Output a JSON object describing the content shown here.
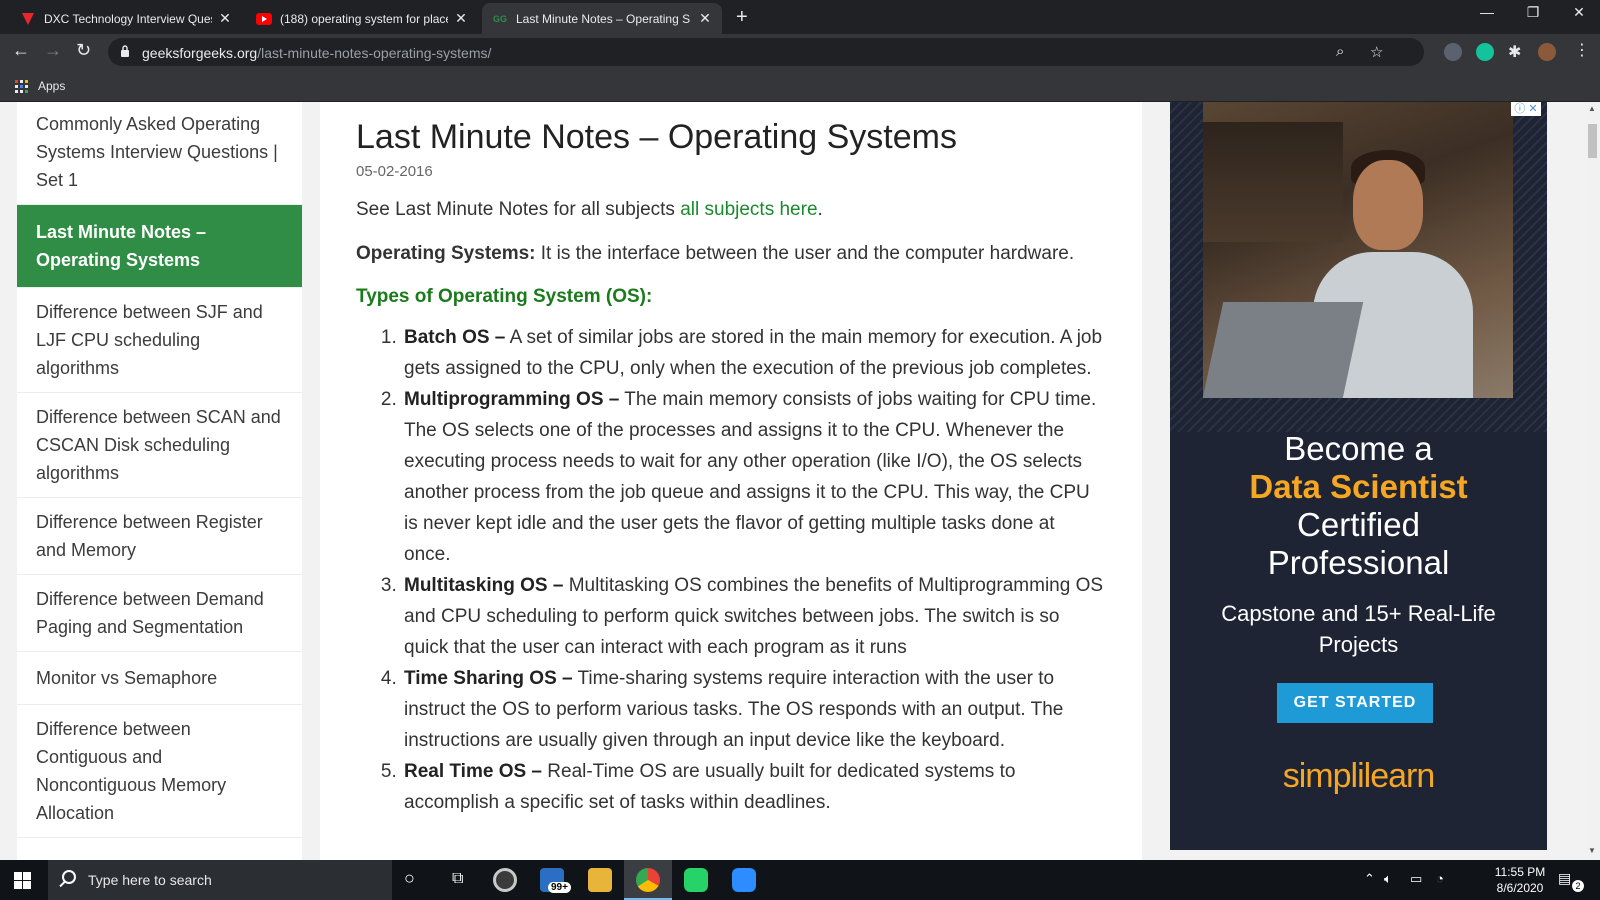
{
  "browser": {
    "tabs": [
      {
        "title": "DXC Technology Interview Quest",
        "icon": "dxc-favicon"
      },
      {
        "title": "(188) operating system for place",
        "icon": "youtube-favicon"
      },
      {
        "title": "Last Minute Notes – Operating S",
        "icon": "gfg-favicon",
        "active": true
      }
    ],
    "new_tab": "+",
    "url_host": "geeksforgeeks.org",
    "url_path": "/last-minute-notes-operating-systems/",
    "bookmarks_apps": "Apps"
  },
  "sidebar": {
    "items": [
      {
        "label": "Commonly Asked Operating Systems Interview Questions | Set 1"
      },
      {
        "label": "Last Minute Notes – Operating Systems",
        "active": true
      },
      {
        "label": "Difference between SJF and LJF CPU scheduling algorithms"
      },
      {
        "label": "Difference between SCAN and CSCAN Disk scheduling algorithms"
      },
      {
        "label": "Difference between Register and Memory"
      },
      {
        "label": "Difference between Demand Paging and Segmentation"
      },
      {
        "label": "Monitor vs Semaphore"
      },
      {
        "label": "Difference between Contiguous and Noncontiguous Memory Allocation"
      }
    ]
  },
  "article": {
    "title": "Last Minute Notes – Operating Systems",
    "date": "05-02-2016",
    "intro_text": "See Last Minute Notes for all subjects ",
    "intro_link": "all subjects here",
    "intro_end": ".",
    "definition_term": "Operating Systems:",
    "definition_text": " It is the interface between the user and the computer hardware.",
    "types_heading": "Types of Operating System (OS):",
    "types": [
      {
        "name": "Batch OS –",
        "text": " A set of similar jobs are stored in the main memory for execution. A job gets assigned to the CPU, only when the execution of the previous job completes."
      },
      {
        "name": "Multiprogramming OS –",
        "text": " The main memory consists of jobs waiting for CPU time. The OS selects one of the processes and assigns it to the CPU. Whenever the executing process needs to wait for any other operation (like I/O), the OS selects another process from the job queue and assigns it to the CPU. This way, the CPU is never kept idle and the user gets the flavor of getting multiple tasks done at once."
      },
      {
        "name": "Multitasking OS –",
        "text": " Multitasking OS combines the benefits of Multiprogramming OS and CPU scheduling to perform quick switches between jobs. The switch is so quick that the user can interact with each program as it runs"
      },
      {
        "name": "Time Sharing OS –",
        "text": " Time-sharing systems require interaction with the user to instruct the OS to perform various tasks. The OS responds with an output. The instructions are usually given through an input device like the keyboard."
      },
      {
        "name": "Real Time OS –",
        "text": " Real-Time OS are usually built for dedicated systems to accomplish a specific set of tasks within deadlines."
      }
    ]
  },
  "ad": {
    "line1": "Become a",
    "line2": "Data Scientist",
    "line3": "Certified",
    "line4": "Professional",
    "sub": "Capstone and 15+ Real-Life Projects",
    "cta": "GET STARTED",
    "logo": "simplilearn"
  },
  "taskbar": {
    "search_placeholder": "Type here to search",
    "mail_badge": "99+",
    "time": "11:55 PM",
    "date": "8/6/2020",
    "notifications": "2"
  },
  "colors": {
    "gfg_green": "#2f8d46",
    "link_green": "#1b8a2e",
    "ad_accent": "#f5a623",
    "ad_button": "#1e9bd7"
  }
}
